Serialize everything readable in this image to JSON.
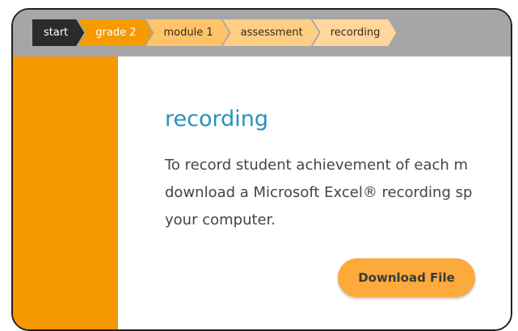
{
  "breadcrumb": {
    "items": [
      {
        "label": "start"
      },
      {
        "label": "grade 2"
      },
      {
        "label": "module 1"
      },
      {
        "label": "assessment"
      },
      {
        "label": "recording"
      }
    ]
  },
  "page": {
    "title": "recording",
    "paragraph_lines": [
      "To record student achievement of each m",
      "download a Microsoft Excel® recording sp",
      "your computer."
    ]
  },
  "download_button": {
    "label": "Download File"
  },
  "colors": {
    "topbar": "#a6a6a6",
    "sidebar": "#f59800",
    "title": "#2c8fc0",
    "button": "#fbaa3b"
  }
}
